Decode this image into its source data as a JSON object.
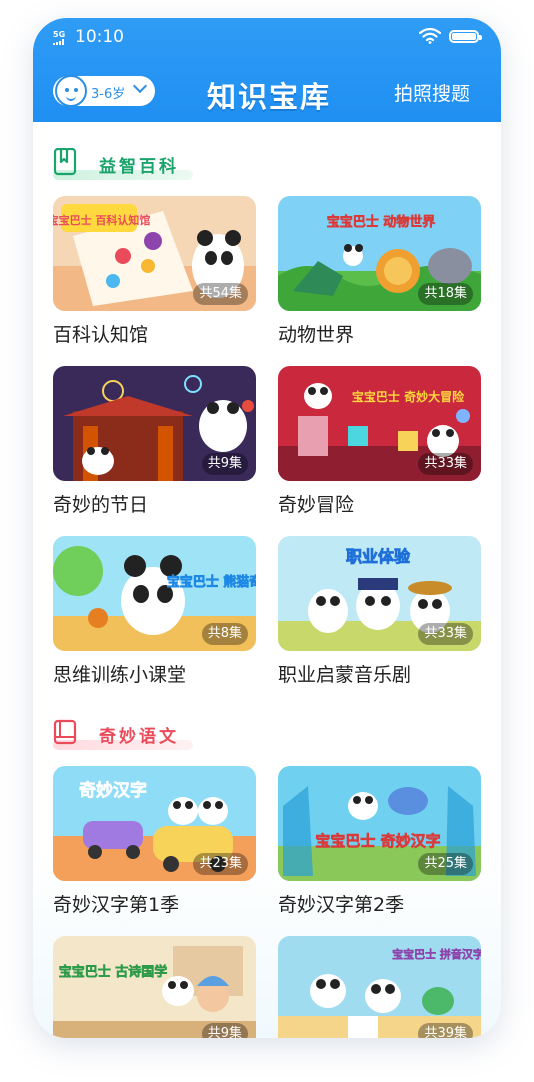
{
  "status_bar": {
    "signal": "5G",
    "time": "10:10"
  },
  "header": {
    "age_selector": "3-6岁",
    "title": "知识宝库",
    "photo_search": "拍照搜题"
  },
  "colors": {
    "brand_blue": "#1f8ff2",
    "section1_green": "#1aa36b",
    "section2_red": "#e94b5a"
  },
  "sections": [
    {
      "title": "益智百科",
      "icon": "bookmark-book-icon",
      "items": [
        {
          "title": "百科认知馆",
          "count": "共54集",
          "art_text": "宝宝巴士 百科认知馆"
        },
        {
          "title": "动物世界",
          "count": "共18集",
          "art_text": "宝宝巴士 动物世界"
        },
        {
          "title": "奇妙的节日",
          "count": "共9集",
          "art_text": ""
        },
        {
          "title": "奇妙冒险",
          "count": "共33集",
          "art_text": "宝宝巴士 奇妙大冒险"
        },
        {
          "title": "思维训练小课堂",
          "count": "共8集",
          "art_text": "宝宝巴士 熊猫奇奇"
        },
        {
          "title": "职业启蒙音乐剧",
          "count": "共33集",
          "art_text": "职业体验"
        }
      ]
    },
    {
      "title": "奇妙语文",
      "icon": "open-book-icon",
      "items": [
        {
          "title": "奇妙汉字第1季",
          "count": "共23集",
          "art_text": "奇妙汉字"
        },
        {
          "title": "奇妙汉字第2季",
          "count": "共25集",
          "art_text": "宝宝巴士 奇妙汉字"
        },
        {
          "title": "",
          "count": "共9集",
          "art_text": "宝宝巴士 古诗国学"
        },
        {
          "title": "",
          "count": "共39集",
          "art_text": "宝宝巴士 拼音汉字"
        }
      ]
    }
  ]
}
